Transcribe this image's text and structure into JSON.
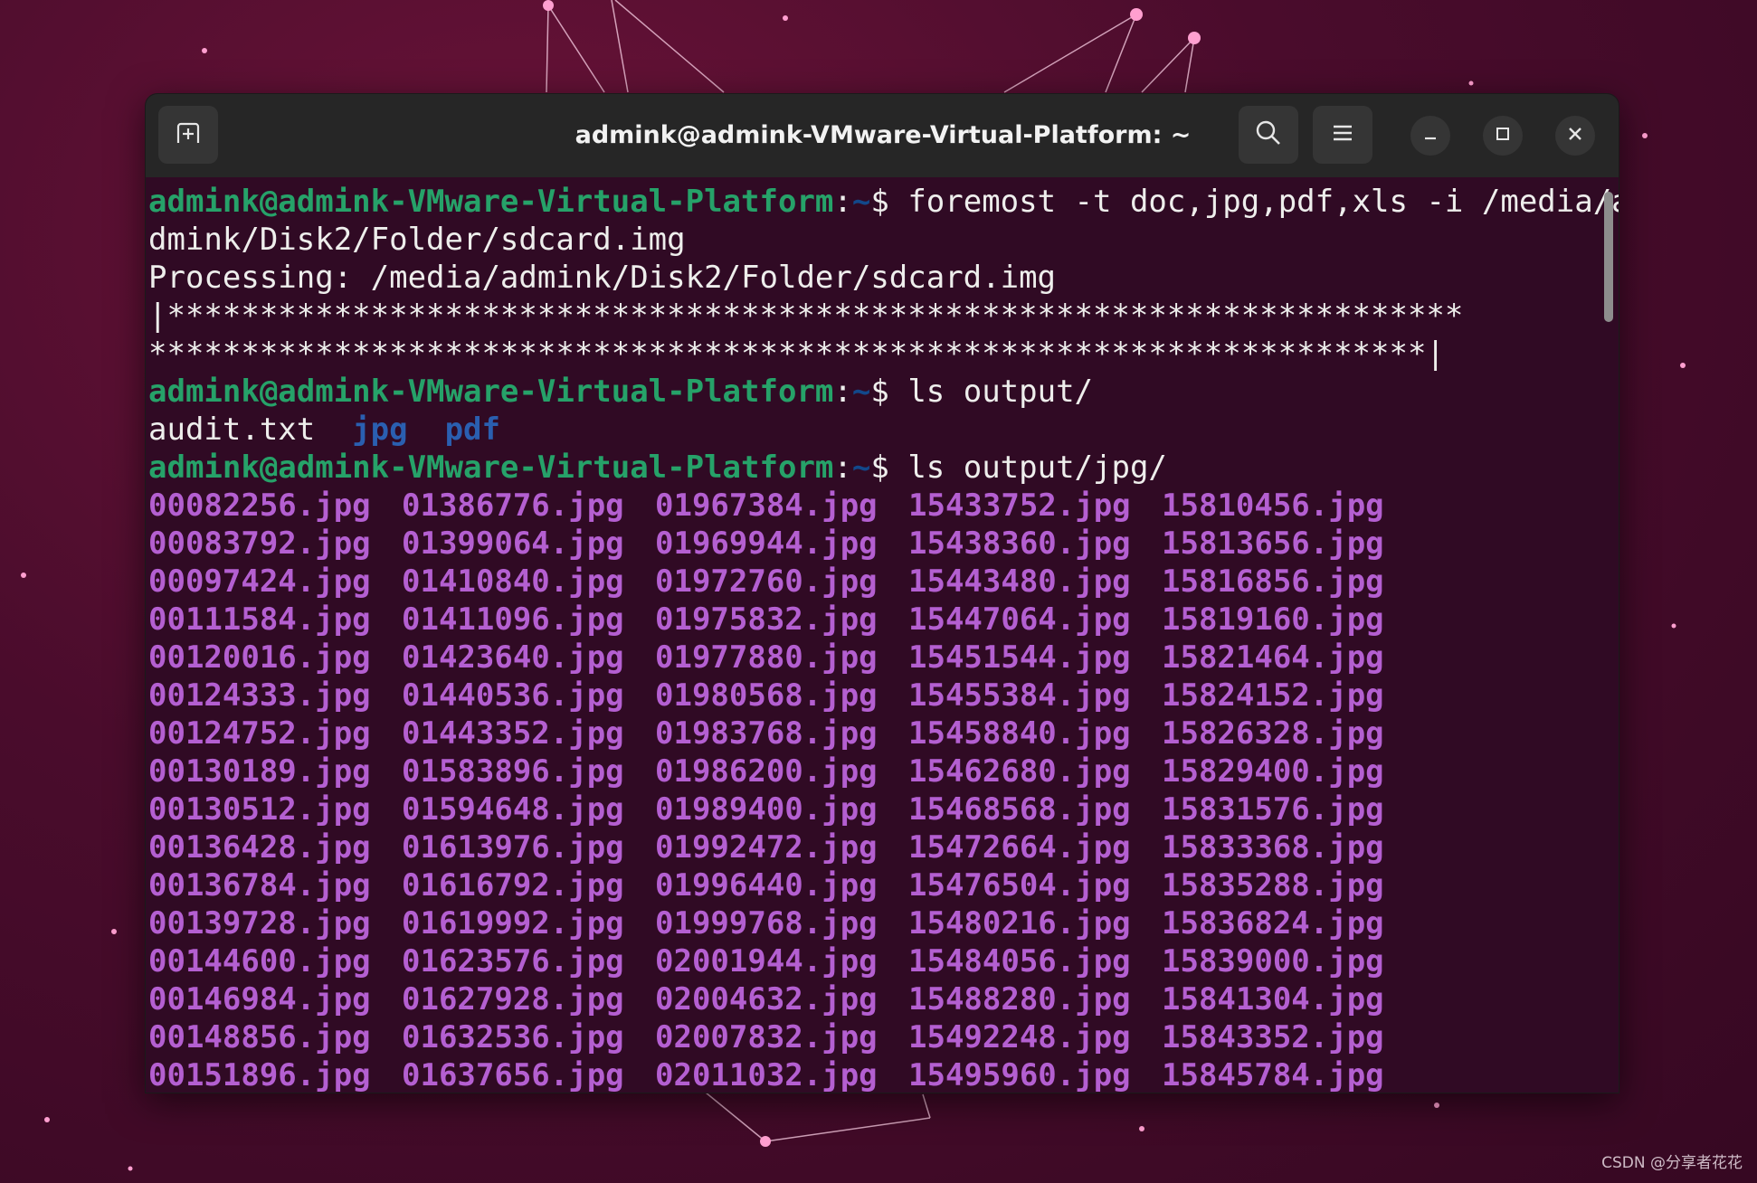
{
  "window": {
    "title": "admink@admink-VMware-Virtual-Platform: ~",
    "icons": {
      "new_tab": "new-tab-icon",
      "search": "search-icon",
      "menu": "hamburger-menu-icon",
      "minimize": "minimize-icon",
      "maximize": "maximize-icon",
      "close": "close-icon"
    }
  },
  "colors": {
    "prompt_user": "#26a269",
    "prompt_path": "#12488b",
    "directory": "#2a5fb0",
    "jpg_file": "#b45fd1",
    "terminal_bg": "#300a24",
    "titlebar_bg": "#262626"
  },
  "terminal": {
    "prompt_user": "admink@admink-VMware-Virtual-Platform",
    "prompt_sep": ":",
    "prompt_path": "~",
    "prompt_dollar": "$ ",
    "cmd1_part1": "foremost -t doc,jpg,pdf,xls -i /media/a",
    "cmd1_part2": "dmink/Disk2/Folder/sdcard.img",
    "processing": "Processing: /media/admink/Disk2/Folder/sdcard.img",
    "progress1": "|**********************************************************************",
    "progress2": "*********************************************************************|",
    "cmd2": "ls output/",
    "ls_file": "audit.txt",
    "ls_dir1": "jpg",
    "ls_dir2": "pdf",
    "cmd3": "ls output/jpg/",
    "jpg_files": [
      [
        "00082256.jpg",
        "01386776.jpg",
        "01967384.jpg",
        "15433752.jpg",
        "15810456.jpg"
      ],
      [
        "00083792.jpg",
        "01399064.jpg",
        "01969944.jpg",
        "15438360.jpg",
        "15813656.jpg"
      ],
      [
        "00097424.jpg",
        "01410840.jpg",
        "01972760.jpg",
        "15443480.jpg",
        "15816856.jpg"
      ],
      [
        "00111584.jpg",
        "01411096.jpg",
        "01975832.jpg",
        "15447064.jpg",
        "15819160.jpg"
      ],
      [
        "00120016.jpg",
        "01423640.jpg",
        "01977880.jpg",
        "15451544.jpg",
        "15821464.jpg"
      ],
      [
        "00124333.jpg",
        "01440536.jpg",
        "01980568.jpg",
        "15455384.jpg",
        "15824152.jpg"
      ],
      [
        "00124752.jpg",
        "01443352.jpg",
        "01983768.jpg",
        "15458840.jpg",
        "15826328.jpg"
      ],
      [
        "00130189.jpg",
        "01583896.jpg",
        "01986200.jpg",
        "15462680.jpg",
        "15829400.jpg"
      ],
      [
        "00130512.jpg",
        "01594648.jpg",
        "01989400.jpg",
        "15468568.jpg",
        "15831576.jpg"
      ],
      [
        "00136428.jpg",
        "01613976.jpg",
        "01992472.jpg",
        "15472664.jpg",
        "15833368.jpg"
      ],
      [
        "00136784.jpg",
        "01616792.jpg",
        "01996440.jpg",
        "15476504.jpg",
        "15835288.jpg"
      ],
      [
        "00139728.jpg",
        "01619992.jpg",
        "01999768.jpg",
        "15480216.jpg",
        "15836824.jpg"
      ],
      [
        "00144600.jpg",
        "01623576.jpg",
        "02001944.jpg",
        "15484056.jpg",
        "15839000.jpg"
      ],
      [
        "00146984.jpg",
        "01627928.jpg",
        "02004632.jpg",
        "15488280.jpg",
        "15841304.jpg"
      ],
      [
        "00148856.jpg",
        "01632536.jpg",
        "02007832.jpg",
        "15492248.jpg",
        "15843352.jpg"
      ],
      [
        "00151896.jpg",
        "01637656.jpg",
        "02011032.jpg",
        "15495960.jpg",
        "15845784.jpg"
      ]
    ]
  },
  "watermark": "CSDN @分享者花花"
}
